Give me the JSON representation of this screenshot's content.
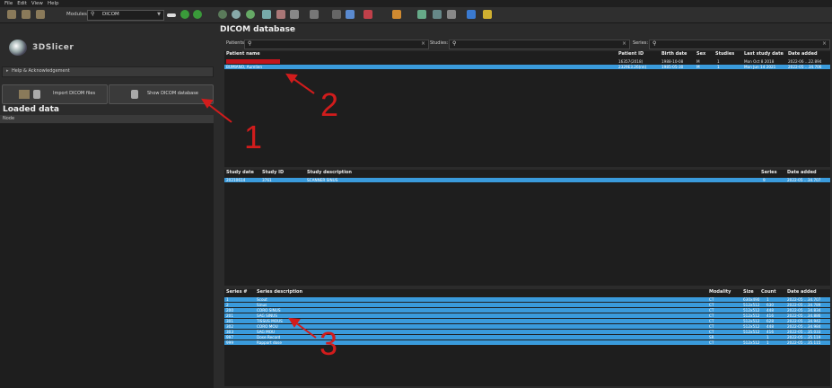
{
  "menu": [
    "File",
    "Edit",
    "View",
    "Help"
  ],
  "toolbar": {
    "modules_label": "Modules:",
    "module_value": "DICOM"
  },
  "app": {
    "logo_text": "3DSlicer"
  },
  "help_section": "Help & Acknowledgement",
  "buttons": {
    "import": "Import DICOM files",
    "show_db": "Show DICOM database"
  },
  "loaded_data": {
    "title": "Loaded data",
    "node_header": "Node"
  },
  "db": {
    "title": "DICOM database",
    "patients_label": "Patients:",
    "studies_label": "Studies:",
    "series_label": "Series:"
  },
  "patients": {
    "headers": [
      "Patient name",
      "Patient ID",
      "Birth date",
      "Sex",
      "Studies",
      "Last study date",
      "Date added"
    ],
    "rows": [
      {
        "name": "",
        "id": "16357(2018)",
        "birth": "1988-10-08",
        "sex": "M",
        "studies": "1",
        "last": "Mon Oct 8 2018",
        "added": "2022-06 ...22.894",
        "redacted": true
      },
      {
        "name": "BUMIANO, Aurelien",
        "id": "2329E3.26(nn)",
        "birth": "1985-05-30",
        "sex": "M",
        "studies": "1",
        "last": "Mon Jun 14 2021",
        "added": "2022-05 ...34.706",
        "selected": true
      }
    ]
  },
  "studies": {
    "headers": [
      "Study date",
      "Study ID",
      "Study description",
      "Series",
      "Date added"
    ],
    "rows": [
      {
        "date": "20210614",
        "id": "3761",
        "desc": "SCANNER SINUS",
        "series": "9",
        "added": "2022-05 ...34.707"
      }
    ]
  },
  "series": {
    "headers": [
      "Series #",
      "Series description",
      "Modality",
      "Size",
      "Count",
      "Date added"
    ],
    "rows": [
      {
        "num": "1",
        "desc": "Scout",
        "mod": "CT",
        "size": "630x490",
        "count": "1",
        "added": "2022-05 ...34.707"
      },
      {
        "num": "2",
        "desc": "Sinus",
        "mod": "CT",
        "size": "512x512",
        "count": "630",
        "added": "2022-05 ...34.789"
      },
      {
        "num": "200",
        "desc": "CORO SINUS",
        "mod": "CT",
        "size": "512x512",
        "count": "448",
        "added": "2022-05 ...34.834"
      },
      {
        "num": "201",
        "desc": "SAG SINUS",
        "mod": "CT",
        "size": "512x512",
        "count": "416",
        "added": "2022-05 ...34.886"
      },
      {
        "num": "301",
        "desc": "TISSUS MOUS",
        "mod": "CT",
        "size": "512x512",
        "count": "628",
        "added": "2022-05 ...34.942"
      },
      {
        "num": "302",
        "desc": "CORO MOU",
        "mod": "CT",
        "size": "512x512",
        "count": "448",
        "added": "2022-05 ...34.984"
      },
      {
        "num": "303",
        "desc": "SAG MOU",
        "mod": "CT",
        "size": "512x512",
        "count": "416",
        "added": "2022-05 ...35.033"
      },
      {
        "num": "997",
        "desc": "Dose Record",
        "mod": "SR",
        "size": "",
        "count": "1",
        "added": "2022-05 ...35.119"
      },
      {
        "num": "999",
        "desc": "Rapport dose",
        "mod": "CT",
        "size": "512x512",
        "count": "1",
        "added": "2022-05 ...35.115"
      }
    ]
  },
  "annotations": [
    "1",
    "2",
    "3"
  ],
  "colors": {
    "selection": "#3a9bdc",
    "annotation": "#d11c1c",
    "panel": "#2b2b2b",
    "table_bg": "#1e1e1e"
  }
}
